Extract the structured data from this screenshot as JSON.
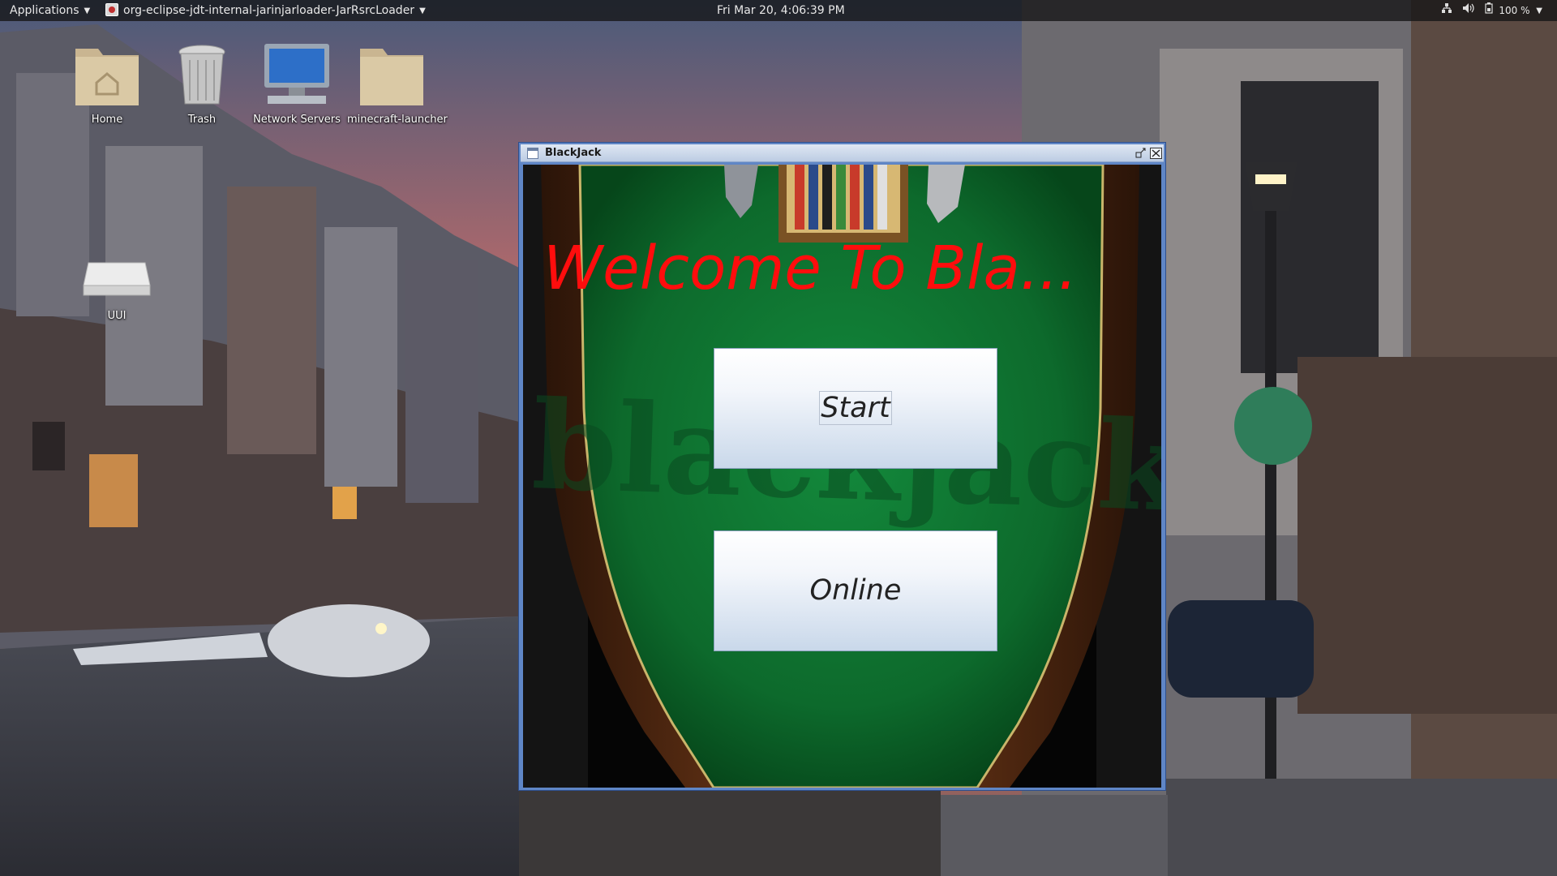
{
  "top_panel": {
    "applications_label": "Applications",
    "task_label": "org-eclipse-jdt-internal-jarinjarloader-JarRsrcLoader",
    "clock": "Fri Mar 20,  4:06:39 PM",
    "battery": "100 %",
    "icons": [
      "network-icon",
      "volume-icon",
      "battery-icon",
      "chevron-down-icon"
    ]
  },
  "desktop": {
    "icons": [
      {
        "label": "Home",
        "icon": "home-folder-icon"
      },
      {
        "label": "Trash",
        "icon": "trash-icon"
      },
      {
        "label": "Network Servers",
        "icon": "network-servers-icon"
      },
      {
        "label": "minecraft-launcher",
        "icon": "folder-icon"
      },
      {
        "label": "UUI",
        "icon": "drive-icon"
      }
    ]
  },
  "window": {
    "title": "BlackJack",
    "welcome_text": "Welcome To Bla...",
    "start_label": "Start",
    "online_label": "Online",
    "colors": {
      "welcome": "#ff0d0d",
      "table_felt": "#0f6a2e",
      "frame": "#5f86c6"
    }
  }
}
